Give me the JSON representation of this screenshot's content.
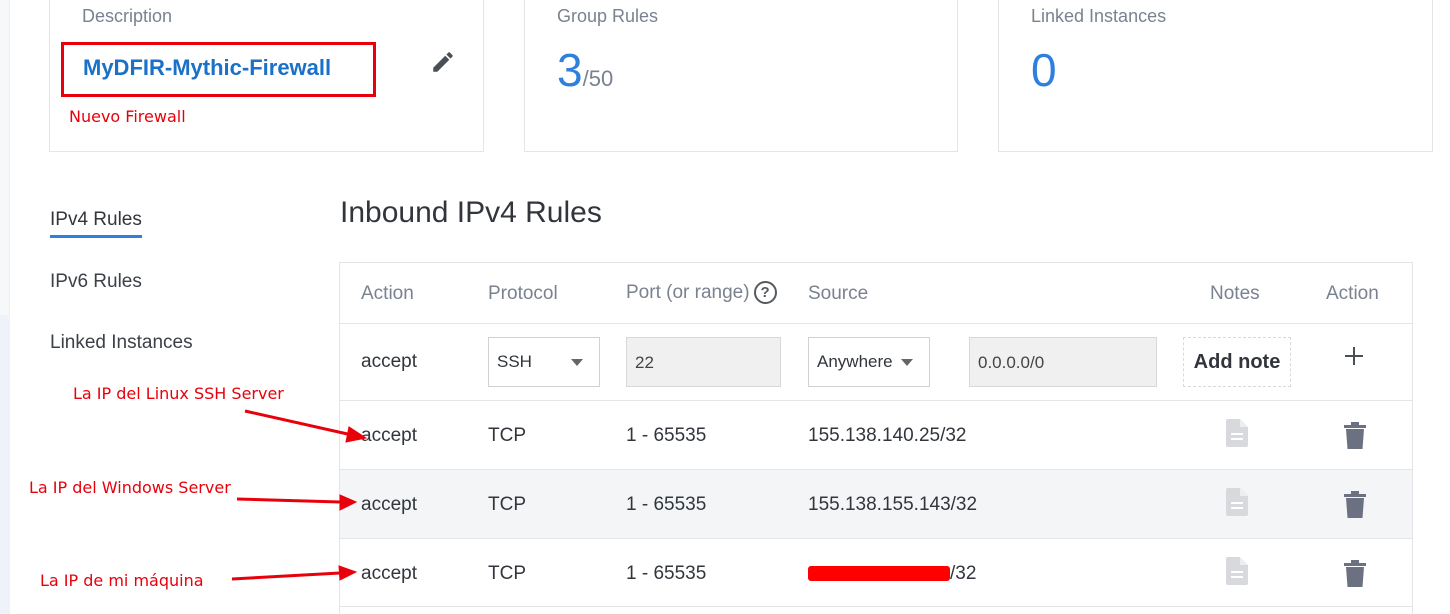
{
  "summary": {
    "description": {
      "label": "Description",
      "value": "MyDFIR-Mythic-Firewall"
    },
    "group_rules": {
      "label": "Group Rules",
      "count": "3",
      "max": "/50"
    },
    "linked_instances": {
      "label": "Linked Instances",
      "count": "0"
    }
  },
  "sidebar": {
    "items": [
      {
        "label": "IPv4 Rules",
        "active": true
      },
      {
        "label": "IPv6 Rules",
        "active": false
      },
      {
        "label": "Linked Instances",
        "active": false
      }
    ]
  },
  "section_title": "Inbound IPv4 Rules",
  "table": {
    "headers": [
      "Action",
      "Protocol",
      "Port (or range)",
      "Source",
      "Notes",
      "Action"
    ],
    "help_glyph": "?",
    "new_rule": {
      "action": "accept",
      "protocol": "SSH",
      "port": "22",
      "source_type": "Anywhere",
      "source_value": "0.0.0.0/0",
      "add_note_label": "Add note"
    },
    "rows": [
      {
        "action": "accept",
        "protocol": "TCP",
        "port": "1 - 65535",
        "source": "155.138.140.25/32"
      },
      {
        "action": "accept",
        "protocol": "TCP",
        "port": "1 - 65535",
        "source": "155.138.155.143/32"
      },
      {
        "action": "accept",
        "protocol": "TCP",
        "port": "1 - 65535",
        "source": "/32"
      }
    ]
  },
  "annotations": {
    "firewall_note": "Nuevo Firewall",
    "linux_ssh": "La IP del Linux SSH Server",
    "windows_server": "La IP del Windows Server",
    "my_machine": "La IP de mi máquina"
  },
  "colors": {
    "accent": "#2f80dd",
    "link": "#1b70c7",
    "annotation": "#e8000b"
  }
}
